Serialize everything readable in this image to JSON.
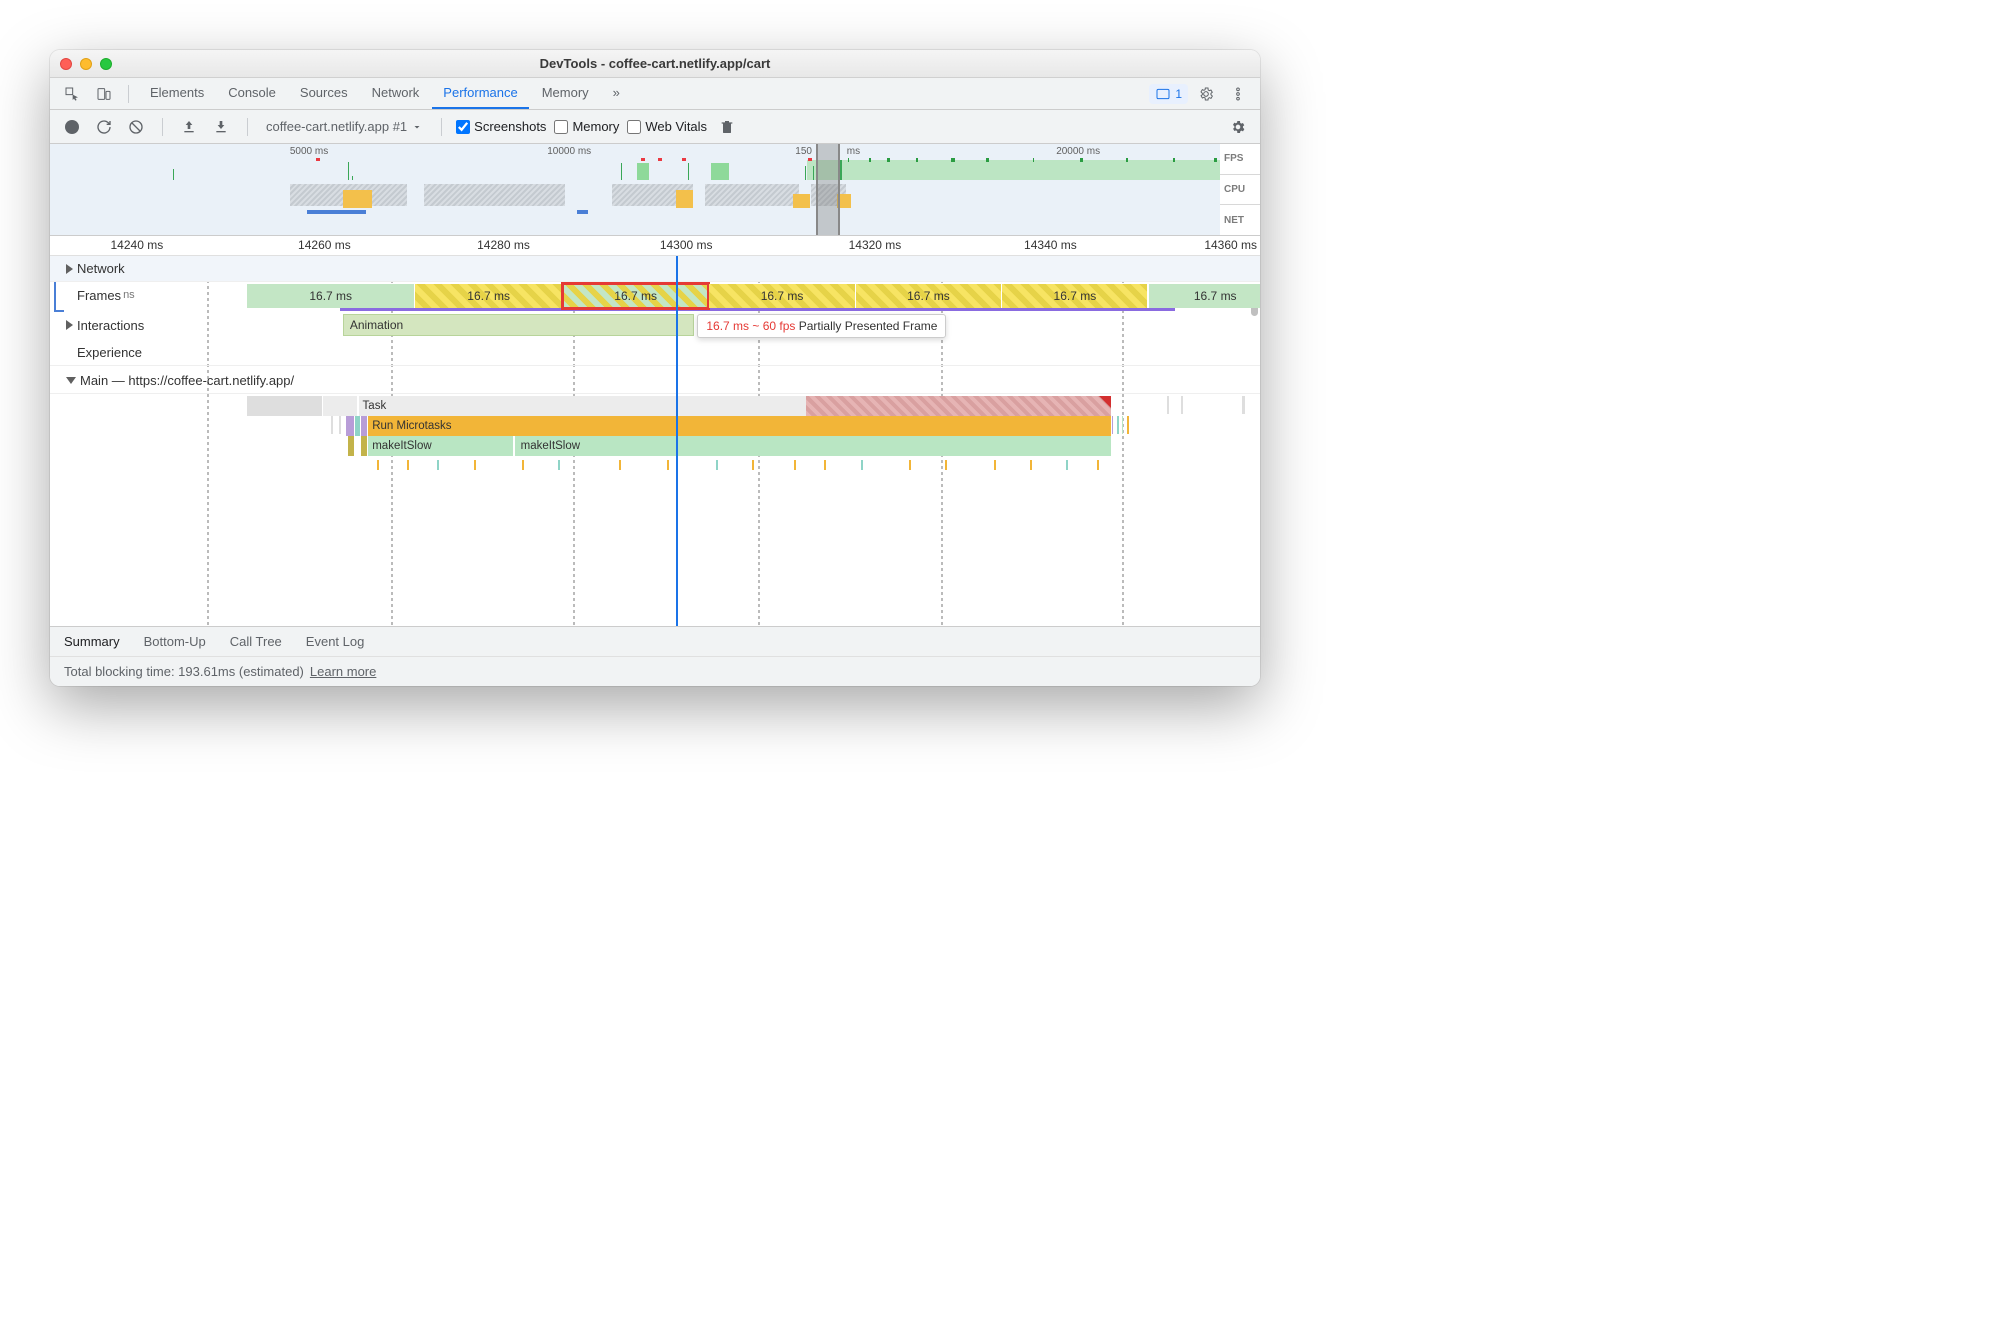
{
  "window": {
    "title": "DevTools - coffee-cart.netlify.app/cart"
  },
  "tabs": {
    "list": [
      "Elements",
      "Console",
      "Sources",
      "Network",
      "Performance",
      "Memory"
    ],
    "active": "Performance",
    "more_icon": "»",
    "issues_count": "1"
  },
  "toolbar": {
    "recording_label": "coffee-cart.netlify.app #1",
    "cb_screenshots": "Screenshots",
    "cb_memory": "Memory",
    "cb_webvitals": "Web Vitals"
  },
  "overview": {
    "ticks": [
      "5000 ms",
      "10000 ms",
      "150",
      "ms",
      "20000 ms"
    ],
    "lanes": {
      "fps": "FPS",
      "cpu": "CPU",
      "net": "NET"
    }
  },
  "ruler": [
    "14240 ms",
    "14260 ms",
    "14280 ms",
    "14300 ms",
    "14320 ms",
    "14340 ms",
    "14360 ms"
  ],
  "tracks": {
    "network": "Network",
    "frames": "Frames",
    "frames_ms_label": "ns",
    "interactions": "Interactions",
    "animation": "Animation",
    "experience": "Experience",
    "main": "Main — https://coffee-cart.netlify.app/"
  },
  "frames": {
    "vals": [
      "16.7 ms",
      "16.7 ms",
      "16.7 ms",
      "16.7 ms",
      "16.7 ms",
      "16.7 ms",
      "16.7 ms"
    ]
  },
  "tooltip": {
    "timing": "16.7 ms ~ 60 fps",
    "label": "Partially Presented Frame"
  },
  "flame": {
    "task": "Task",
    "micro": "Run Microtasks",
    "fn": "makeItSlow"
  },
  "bottom_tabs": {
    "list": [
      "Summary",
      "Bottom-Up",
      "Call Tree",
      "Event Log"
    ],
    "active": "Summary"
  },
  "footer": {
    "tbt": "Total blocking time: 193.61ms (estimated)",
    "learn": "Learn more"
  }
}
